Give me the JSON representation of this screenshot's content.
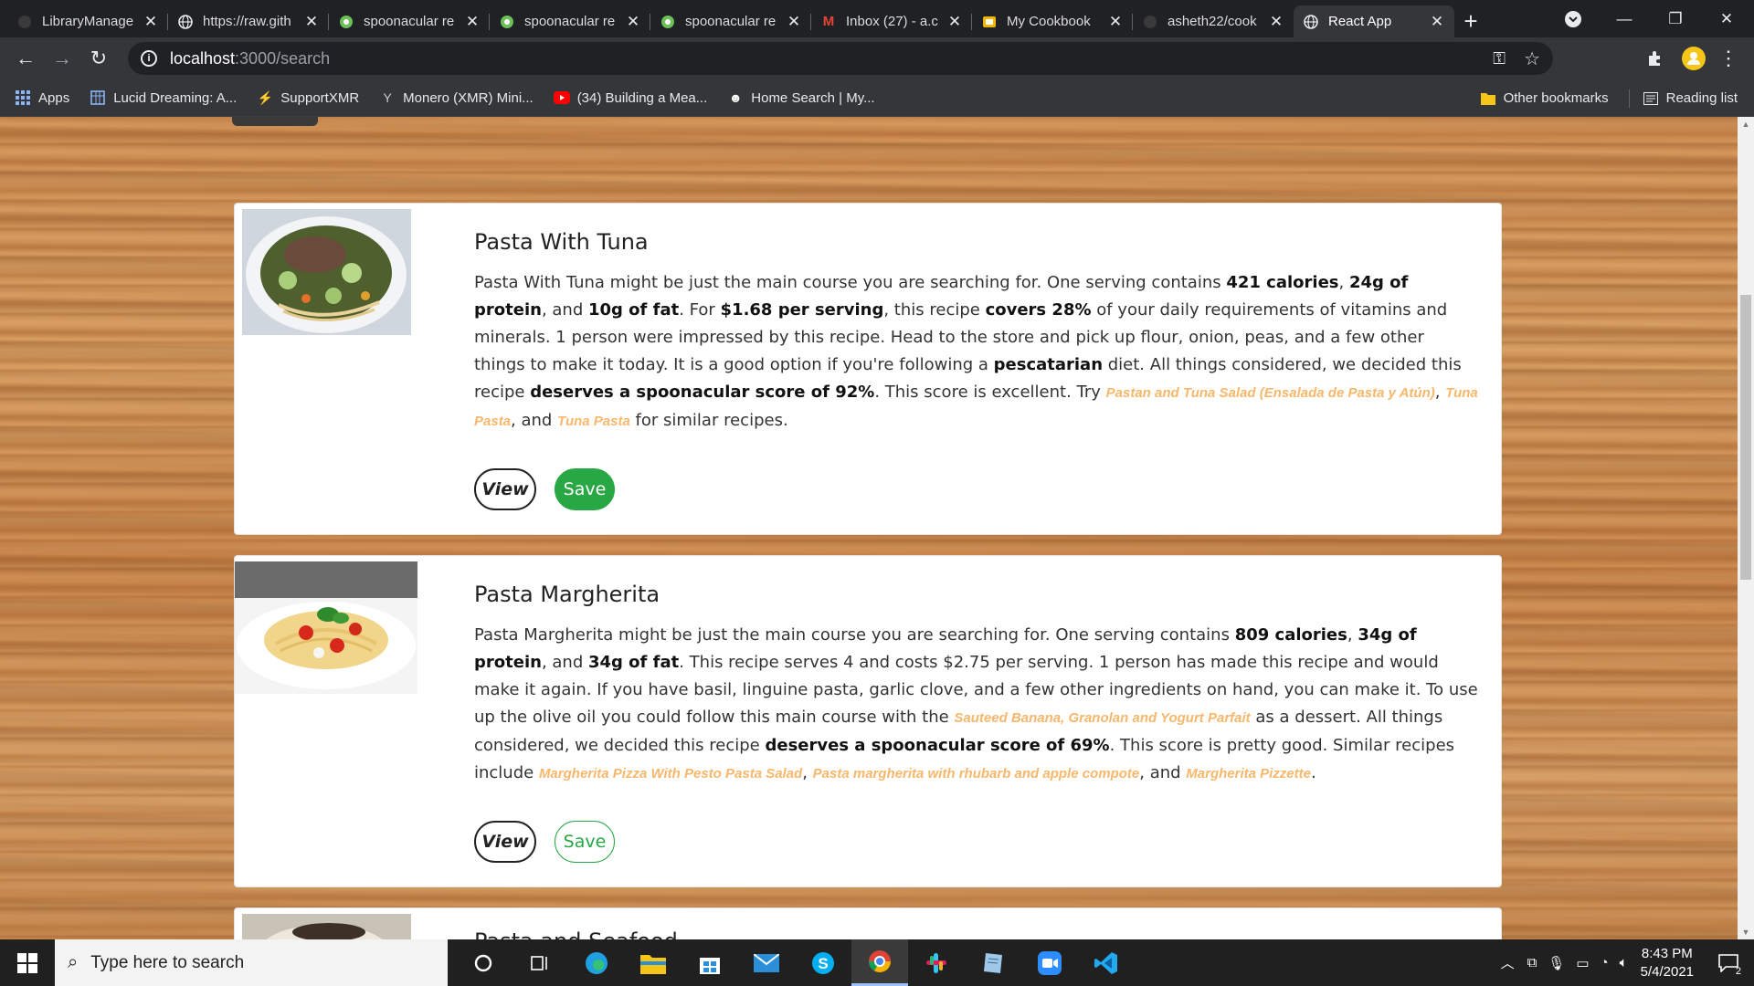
{
  "browser": {
    "tabs": [
      {
        "title": "LibraryManage",
        "icon": "github-icon"
      },
      {
        "title": "https://raw.gith",
        "icon": "globe-icon"
      },
      {
        "title": "spoonacular re",
        "icon": "spoonacular-icon"
      },
      {
        "title": "spoonacular re",
        "icon": "spoonacular-icon"
      },
      {
        "title": "spoonacular re",
        "icon": "spoonacular-icon"
      },
      {
        "title": "Inbox (27) - a.c",
        "icon": "gmail-icon"
      },
      {
        "title": "My Cookbook",
        "icon": "slides-icon"
      },
      {
        "title": "asheth22/cook",
        "icon": "github-icon"
      },
      {
        "title": "React App",
        "icon": "globe-icon",
        "active": true
      }
    ],
    "address": {
      "host": "localhost",
      "path": ":3000/search"
    },
    "bookmarks": [
      {
        "label": "Apps",
        "icon": "apps-grid-icon"
      },
      {
        "label": "Lucid Dreaming: A...",
        "icon": "calendar-icon"
      },
      {
        "label": "SupportXMR",
        "icon": "bolt-icon"
      },
      {
        "label": "Monero (XMR) Mini...",
        "icon": "pickaxe-icon"
      },
      {
        "label": "(34) Building a Mea...",
        "icon": "youtube-icon"
      },
      {
        "label": "Home Search | My...",
        "icon": "smiley-icon"
      }
    ],
    "other_bookmarks": "Other bookmarks",
    "reading_list": "Reading list"
  },
  "recipes": [
    {
      "title": "Pasta With Tuna",
      "save_label": "Save",
      "view_label": "View",
      "save_style": "filled",
      "summary": "Pasta With Tuna might be just the main course you are searching for. One serving contains <b>421 calories</b>, <b>24g of protein</b>, and <b>10g of fat</b>. For <b>$1.68 per serving</b>, this recipe <b>covers 28%</b> of your daily requirements of vitamins and minerals. 1 person were impressed by this recipe. Head to the store and pick up flour, onion, peas, and a few other things to make it today. It is a good option if you're following a <b>pescatarian</b> diet. All things considered, we decided this recipe <b>deserves a spoonacular score of 92%</b>. This score is excellent. Try <a>Pastan and Tuna Salad (Ensalada de Pasta y Atún)</a>, <a>Tuna Pasta</a>, and <a>Tuna Pasta</a> for similar recipes."
    },
    {
      "title": "Pasta Margherita",
      "save_label": "Save",
      "view_label": "View",
      "save_style": "outline",
      "summary": "Pasta Margherita might be just the main course you are searching for. One serving contains <b>809 calories</b>, <b>34g of protein</b>, and <b>34g of fat</b>. This recipe serves 4 and costs $2.75 per serving. 1 person has made this recipe and would make it again. If you have basil, linguine pasta, garlic clove, and a few other ingredients on hand, you can make it. To use up the olive oil you could follow this main course with the <a>Sauteed Banana, Granolan and Yogurt Parfait</a> as a dessert. All things considered, we decided this recipe <b>deserves a spoonacular score of 69%</b>. This score is pretty good. Similar recipes include <a>Margherita Pizza With Pesto Pasta Salad</a>, <a>Pasta margherita with rhubarb and apple compote</a>, and <a>Margherita Pizzette</a>."
    },
    {
      "title": "Pasta and Seafood"
    }
  ],
  "taskbar": {
    "search_placeholder": "Type here to search",
    "time": "8:43 PM",
    "date": "5/4/2021",
    "notifications": "2",
    "apps": [
      "cortana-icon",
      "task-view-icon",
      "edge-icon",
      "file-explorer-icon",
      "store-icon",
      "mail-icon",
      "skype-icon",
      "chrome-icon",
      "slack-icon",
      "notepad-icon",
      "zoom-icon",
      "vscode-icon"
    ]
  },
  "colors": {
    "save_green": "#28a745",
    "link_orange": "#f8b76b"
  }
}
